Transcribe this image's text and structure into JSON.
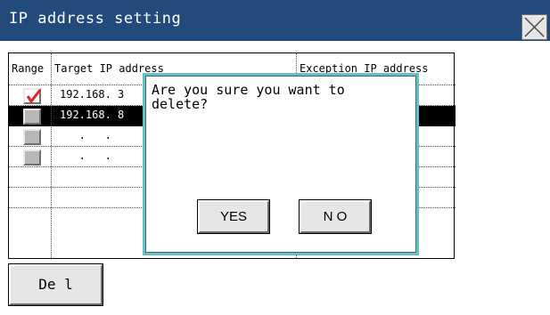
{
  "window": {
    "title": "IP address setting",
    "close_icon": "close-x-icon"
  },
  "table": {
    "headers": {
      "range": "Range",
      "target_ip": "Target IP address",
      "exception_ip": "Exception IP address"
    },
    "rows": [
      {
        "checked": true,
        "target_ip": "192.168. 3",
        "selected": false
      },
      {
        "checked": false,
        "target_ip": "192.168. 8",
        "selected": true
      },
      {
        "checked": false,
        "target_ip": "   .   .",
        "selected": false
      },
      {
        "checked": false,
        "target_ip": "   .   .",
        "selected": false
      },
      {
        "checked": null,
        "target_ip": "",
        "selected": false
      },
      {
        "checked": null,
        "target_ip": "",
        "selected": false
      }
    ]
  },
  "actions": {
    "delete_label": "De l"
  },
  "dialog": {
    "message": "Are you sure you want to\ndelete?",
    "yes_label": "YES",
    "no_label": "N O"
  },
  "colors": {
    "titlebar": "#224b7c",
    "dialog_border": "#6cbcc4",
    "checkmark": "#e0262c",
    "selected_row": "#000000"
  }
}
